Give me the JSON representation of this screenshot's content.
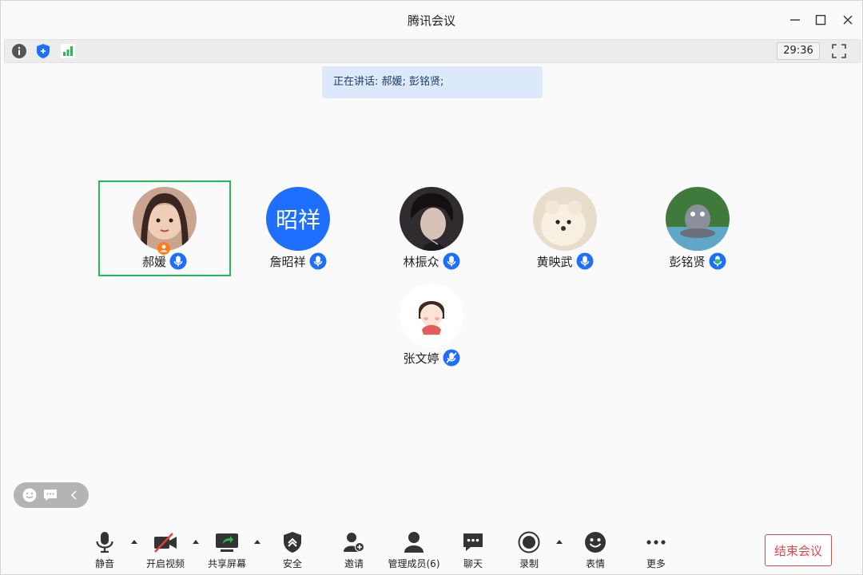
{
  "window": {
    "title": "腾讯会议"
  },
  "status": {
    "timer": "29:36"
  },
  "speaking": {
    "text": "正在讲话: 郝媛; 彭铭贤;"
  },
  "participants": [
    {
      "name": "郝媛",
      "host": true,
      "active": true,
      "avatar": "photo"
    },
    {
      "name": "詹昭祥",
      "host": false,
      "active": false,
      "avatar_text": "昭祥",
      "avatar_color": "#1e6fff"
    },
    {
      "name": "林振众",
      "host": false,
      "active": false,
      "avatar": "photo"
    },
    {
      "name": "黄映武",
      "host": false,
      "active": false,
      "avatar": "photo"
    },
    {
      "name": "彭铭贤",
      "host": false,
      "active": false,
      "avatar": "photo",
      "mic_state": "speaking"
    },
    {
      "name": "张文婷",
      "host": false,
      "active": false,
      "avatar": "illustration",
      "mic_state": "muted"
    }
  ],
  "toolbar": {
    "mute": "静音",
    "video": "开启视频",
    "share": "共享屏幕",
    "security": "安全",
    "invite": "邀请",
    "members": "管理成员(6)",
    "chat": "聊天",
    "record": "录制",
    "emoji": "表情",
    "more": "更多",
    "end": "结束会议"
  },
  "colors": {
    "accent": "#1e6fff",
    "active_border": "#22bb55",
    "end": "#e0484c",
    "speaking_bg": "#dbe9fb"
  },
  "icons": [
    "info-icon",
    "shield-icon",
    "signal-icon",
    "fullscreen-icon",
    "mic-icon",
    "video-off-icon",
    "share-screen-icon",
    "security-icon",
    "invite-icon",
    "members-icon",
    "chat-icon",
    "record-icon",
    "emoji-icon",
    "more-icon"
  ]
}
